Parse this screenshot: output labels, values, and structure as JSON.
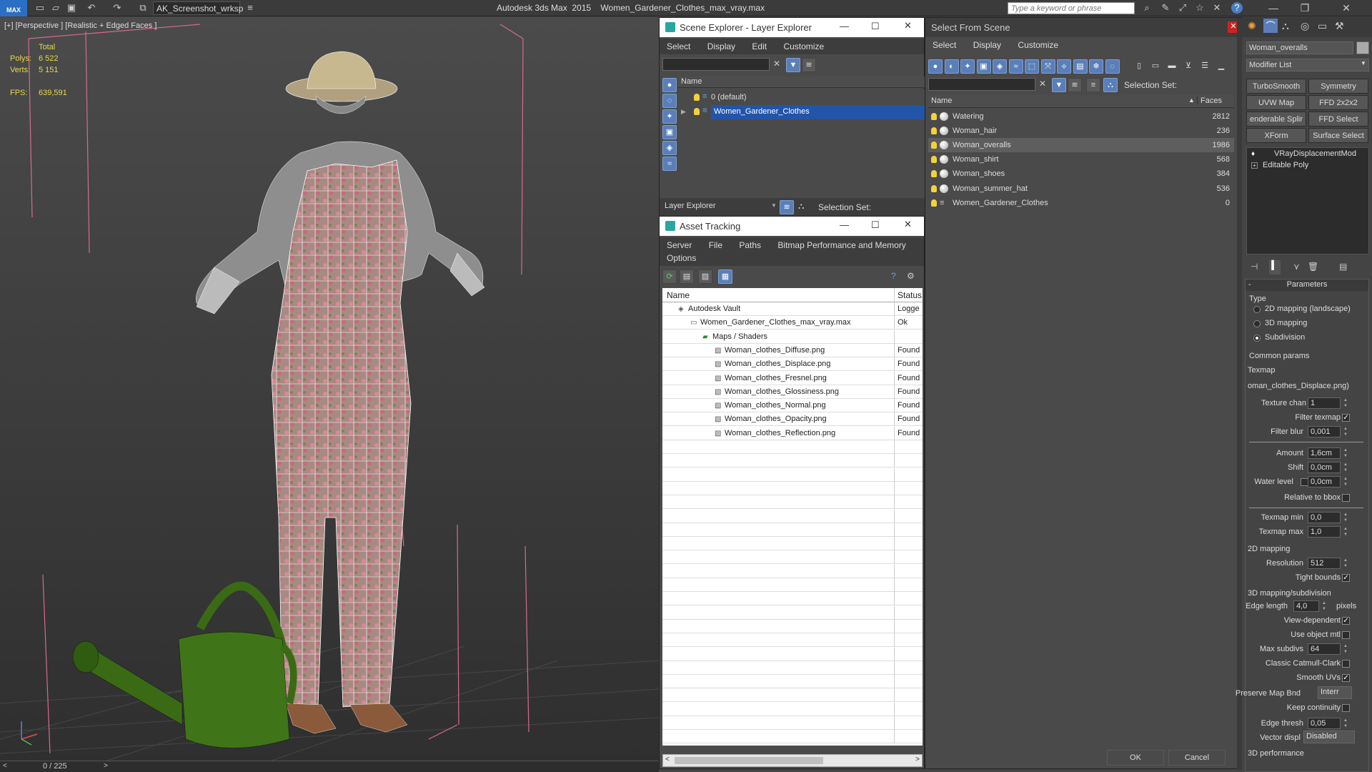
{
  "app": {
    "title": "Autodesk 3ds Max  2015    Women_Gardener_Clothes_max_vray.max",
    "logo": "MAX",
    "workspace": "AK_Screenshot_wrksp",
    "search_placeholder": "Type a keyword or phrase"
  },
  "viewport": {
    "label": "[+] [Perspective ] [Realistic + Edged Faces ]",
    "stats": {
      "total_label": "Total",
      "polys_label": "Polys:",
      "polys": "6 522",
      "verts_label": "Verts:",
      "verts": "5 151",
      "fps_label": "FPS:",
      "fps": "639,591"
    },
    "timeline": "0 / 225"
  },
  "scene_explorer": {
    "title": "Scene Explorer - Layer Explorer",
    "menu": [
      "Select",
      "Display",
      "Edit",
      "Customize"
    ],
    "col_name": "Name",
    "rows": [
      {
        "label": "0 (default)",
        "selected": false
      },
      {
        "label": "Women_Gardener_Clothes",
        "selected": true
      }
    ],
    "footer_dropdown": "Layer Explorer",
    "selection_set": "Selection Set:"
  },
  "asset_tracking": {
    "title": "Asset Tracking",
    "menu": [
      "Server",
      "File",
      "Paths",
      "Bitmap Performance and Memory",
      "Options"
    ],
    "col_name": "Name",
    "col_status": "Status",
    "rows": [
      {
        "label": "Autodesk Vault",
        "status": "Logge",
        "indent": 0
      },
      {
        "label": "Women_Gardener_Clothes_max_vray.max",
        "status": "Ok",
        "indent": 1
      },
      {
        "label": "Maps / Shaders",
        "status": "",
        "indent": 2
      },
      {
        "label": "Woman_clothes_Diffuse.png",
        "status": "Found",
        "indent": 3
      },
      {
        "label": "Woman_clothes_Displace.png",
        "status": "Found",
        "indent": 3
      },
      {
        "label": "Woman_clothes_Fresnel.png",
        "status": "Found",
        "indent": 3
      },
      {
        "label": "Woman_clothes_Glossiness.png",
        "status": "Found",
        "indent": 3
      },
      {
        "label": "Woman_clothes_Normal.png",
        "status": "Found",
        "indent": 3
      },
      {
        "label": "Woman_clothes_Opacity.png",
        "status": "Found",
        "indent": 3
      },
      {
        "label": "Woman_clothes_Reflection.png",
        "status": "Found",
        "indent": 3
      }
    ]
  },
  "select_from_scene": {
    "title": "Select From Scene",
    "menu": [
      "Select",
      "Display",
      "Customize"
    ],
    "selection_set": "Selection Set:",
    "col_name": "Name",
    "col_faces": "Faces",
    "rows": [
      {
        "label": "Watering",
        "faces": "2812",
        "selected": false
      },
      {
        "label": "Woman_hair",
        "faces": "236",
        "selected": false
      },
      {
        "label": "Woman_overalls",
        "faces": "1986",
        "selected": true
      },
      {
        "label": "Woman_shirt",
        "faces": "568",
        "selected": false
      },
      {
        "label": "Woman_shoes",
        "faces": "384",
        "selected": false
      },
      {
        "label": "Woman_summer_hat",
        "faces": "536",
        "selected": false
      },
      {
        "label": "Women_Gardener_Clothes",
        "faces": "0",
        "selected": false
      }
    ],
    "ok": "OK",
    "cancel": "Cancel"
  },
  "command_panel": {
    "object_name": "Woman_overalls",
    "modifier_list": "Modifier List",
    "mod_buttons": [
      "TurboSmooth",
      "Symmetry",
      "UVW Map",
      "FFD 2x2x2",
      "enderable Splir",
      "FFD Select",
      "XForm",
      "Surface Select"
    ],
    "stack": [
      "VRayDisplacementMod",
      "Editable Poly"
    ],
    "rollout": "Parameters",
    "type_label": "Type",
    "type_options": [
      "2D mapping (landscape)",
      "3D mapping",
      "Subdivision"
    ],
    "common_params": "Common params",
    "texmap_label": "Texmap",
    "texmap_value": "oman_clothes_Displace.png)",
    "texture_chan_label": "Texture chan",
    "texture_chan": "1",
    "filter_texmap": "Filter texmap",
    "filter_blur_label": "Filter blur",
    "filter_blur": "0,001",
    "amount_label": "Amount",
    "amount": "1,6cm",
    "shift_label": "Shift",
    "shift": "0,0cm",
    "water_level_label": "Water level",
    "water_level": "0,0cm",
    "relative_bbox": "Relative to bbox",
    "texmap_min_label": "Texmap min",
    "texmap_min": "0,0",
    "texmap_max_label": "Texmap max",
    "texmap_max": "1,0",
    "map2d": "2D mapping",
    "resolution_label": "Resolution",
    "resolution": "512",
    "tight_bounds": "Tight bounds",
    "map3d": "3D mapping/subdivision",
    "edge_length_label": "Edge length",
    "edge_length": "4,0",
    "pixels": "pixels",
    "view_dependent": "View-dependent",
    "use_object_mtl": "Use object mtl",
    "max_subdivs_label": "Max subdivs",
    "max_subdivs": "64",
    "classic_cc": "Classic Catmull-Clark",
    "smooth_uvs": "Smooth UVs",
    "preserve_map_label": "Preserve Map Bnd",
    "preserve_map": "Interr",
    "keep_continuity": "Keep continuity",
    "edge_thresh_label": "Edge thresh",
    "edge_thresh": "0,05",
    "vector_displ_label": "Vector displ",
    "vector_displ": "Disabled",
    "perf": "3D performance"
  }
}
